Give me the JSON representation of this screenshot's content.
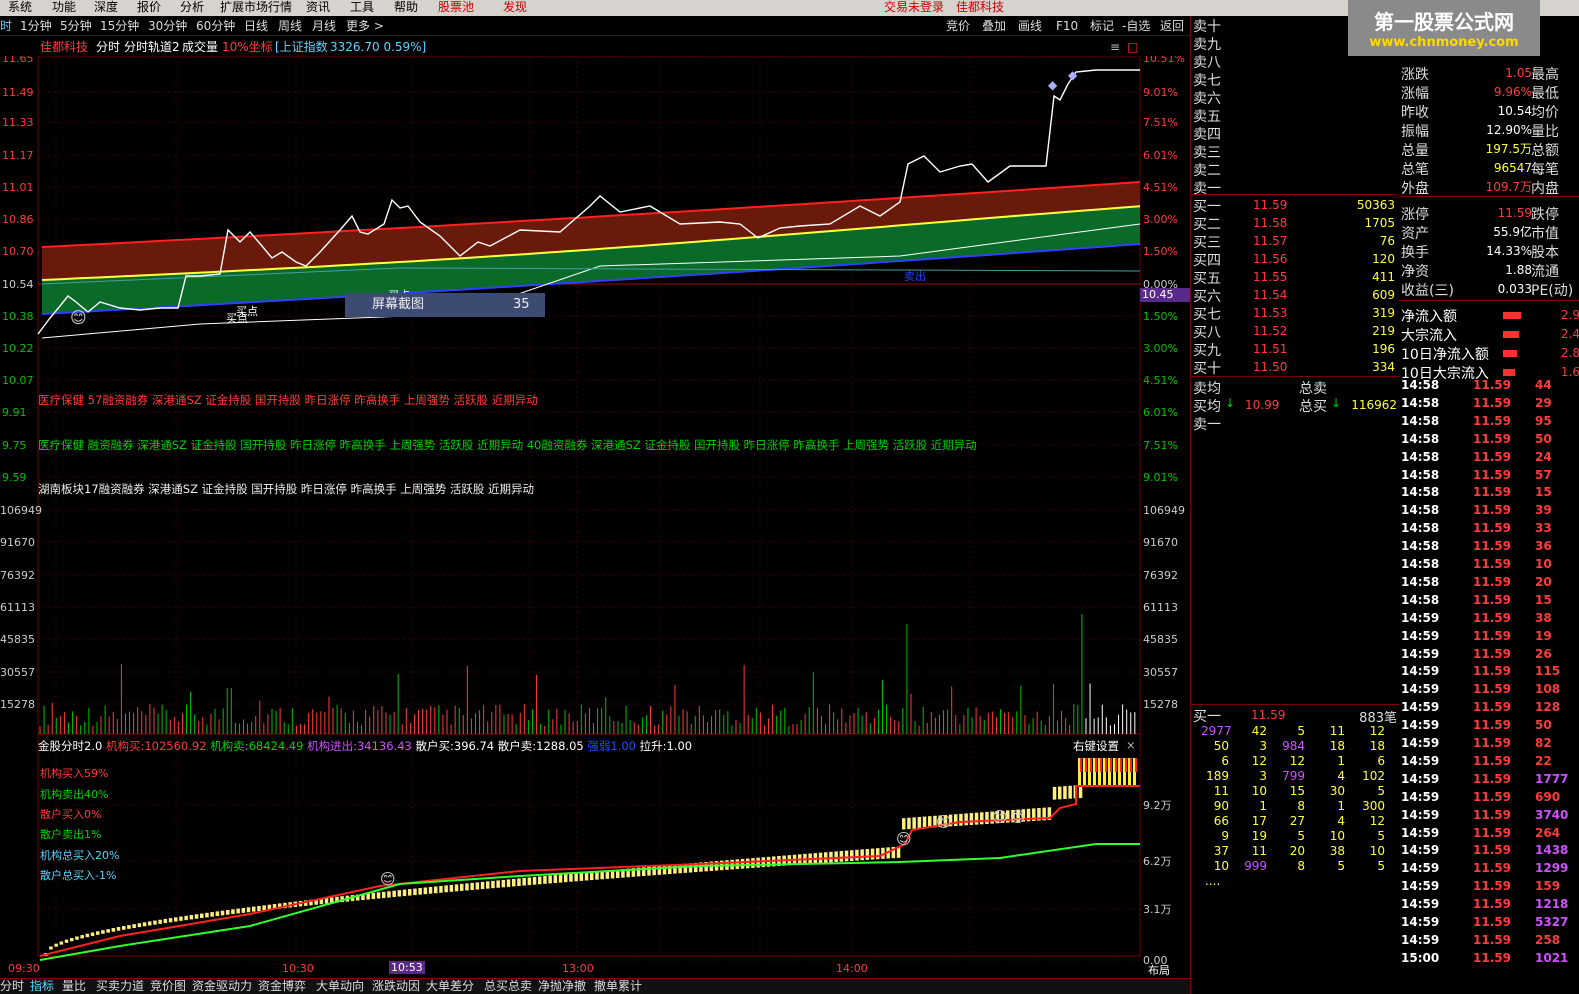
{
  "menu": [
    "系统",
    "功能",
    "深度",
    "报价",
    "分析",
    "扩展市场行情",
    "资讯",
    "工具",
    "帮助",
    "股票池",
    "发现",
    "交易未登录",
    "佳都科技"
  ],
  "watermark": {
    "title": "第一股票公式网",
    "url": "www.chnmoney.com"
  },
  "period_tabs": [
    "时",
    "1分钟",
    "5分钟",
    "15分钟",
    "30分钟",
    "60分钟",
    "日线",
    "周线",
    "月线",
    "更多 >"
  ],
  "right_tools": [
    "竞价",
    "叠加",
    "画线",
    "F10",
    "标记",
    "-自选",
    "返回"
  ],
  "title": {
    "stock": "佳都科技",
    "items": [
      "分时",
      "分时轨道2",
      "成交量"
    ],
    "coord": "10%坐标",
    "index": "[上证指数",
    "index_val": "3326.70 0.59%]"
  },
  "price_axis": [
    "11.65",
    "11.49",
    "11.33",
    "11.17",
    "11.01",
    "10.86",
    "10.70",
    "10.54",
    "10.38",
    "10.22",
    "10.07",
    "9.91",
    "9.75",
    "9.59"
  ],
  "pct_axis": [
    "10.51%",
    "9.01%",
    "7.51%",
    "6.01%",
    "4.51%",
    "3.00%",
    "1.50%",
    "0.00%",
    "1.50%",
    "3.00%",
    "4.51%",
    "6.01%",
    "7.51%",
    "9.01%"
  ],
  "cur_price": "10.45",
  "annotations": {
    "buy1": "买点",
    "buy2": "买点",
    "buy3": "买点",
    "sell_label": "卖出",
    "screenshot": "屏幕截图",
    "screenshot_num": "35"
  },
  "concepts": [
    "医疗保健 57融资融券 深港通SZ 证金持股 国开持股 昨日涨停 昨高换手 上周强势 活跃股 近期异动",
    "医疗保健 融资融券 深港通SZ 证金持股 国开持股 昨日涨停 昨高换手 上周强势 活跃股 近期异动 40融资融券 深港通SZ 证金持股 国开持股 昨日涨停 昨高换手 上周强势 活跃股 近期异动",
    "湖南板块17融资融券 深港通SZ 证金持股 国开持股 昨日涨停 昨高换手 上周强势 活跃股 近期异动"
  ],
  "vol_axis": [
    "106949",
    "91670",
    "76392",
    "61113",
    "45835",
    "30557",
    "15278"
  ],
  "ind": {
    "name": "金股分时2.0",
    "a": "机构买:",
    "a_v": "102560.92",
    "b": "机构卖:",
    "b_v": "68424.49",
    "c": "机构进出:",
    "c_v": "34136.43",
    "d": "散户买:",
    "d_v": "396.74",
    "e": "散户卖:",
    "e_v": "1288.05",
    "f": "强弱",
    "f_v": "1.00",
    "g": "拉升:",
    "g_v": "1.00",
    "settings": "右键设置",
    "close": "×"
  },
  "ind_labels": [
    "机构买入59%",
    "机构卖出40%",
    "散户买入0%",
    "散户卖出1%",
    "机构总买入20%",
    "散户总买入-1%"
  ],
  "ind_axis": [
    "9.2万",
    "6.2万",
    "3.1万",
    "0.00"
  ],
  "time_axis": [
    "09:30",
    "10:30",
    "10:53",
    "13:00",
    "14:00"
  ],
  "layout_label": "布局",
  "bottom_tabs": [
    "分时",
    "指标",
    "量比",
    "买卖力道",
    "竞价图",
    "资金驱动力",
    "资金博弈",
    "大单动向",
    "涨跌动因",
    "大单差分",
    "总买总卖",
    "净抛净撤",
    "撤单累计"
  ],
  "sell_levels": [
    "卖十",
    "卖九",
    "卖八",
    "卖七",
    "卖六",
    "卖五",
    "卖四",
    "卖三",
    "卖二",
    "卖一"
  ],
  "buy_levels": [
    {
      "l": "买一",
      "p": "11.59",
      "v": "50363"
    },
    {
      "l": "买二",
      "p": "11.58",
      "v": "1705"
    },
    {
      "l": "买三",
      "p": "11.57",
      "v": "76"
    },
    {
      "l": "买四",
      "p": "11.56",
      "v": "120"
    },
    {
      "l": "买五",
      "p": "11.55",
      "v": "411"
    },
    {
      "l": "买六",
      "p": "11.54",
      "v": "609"
    },
    {
      "l": "买七",
      "p": "11.53",
      "v": "319"
    },
    {
      "l": "买八",
      "p": "11.52",
      "v": "219"
    },
    {
      "l": "买九",
      "p": "11.51",
      "v": "196"
    },
    {
      "l": "买十",
      "p": "11.50",
      "v": "334"
    }
  ],
  "quote": [
    {
      "k": "涨跌",
      "v": "1.05",
      "k2": "最高"
    },
    {
      "k": "涨幅",
      "v": "9.96%",
      "k2": "最低"
    },
    {
      "k": "昨收",
      "v": "10.54",
      "k2": "均价"
    },
    {
      "k": "振幅",
      "v": "12.90%",
      "k2": "量比"
    },
    {
      "k": "总量",
      "v": "197.5万",
      "k2": "总额"
    },
    {
      "k": "总笔",
      "v": "96547",
      "k2": "每笔"
    },
    {
      "k": "外盘",
      "v": "109.7万",
      "k2": "内盘"
    }
  ],
  "quote2": [
    {
      "k": "涨停",
      "v": "11.59",
      "k2": "跌停"
    },
    {
      "k": "资产",
      "v": "55.9亿",
      "k2": "市值"
    },
    {
      "k": "换手",
      "v": "14.33%",
      "k2": "股本"
    },
    {
      "k": "净资",
      "v": "1.88",
      "k2": "流通"
    },
    {
      "k": "收益(三)",
      "v": "0.033",
      "k2": "PE(动)"
    }
  ],
  "flow": [
    {
      "k": "净流入额",
      "v": "2.9"
    },
    {
      "k": "大宗流入",
      "v": "2.4"
    },
    {
      "k": "10日净流入额",
      "v": "2.8"
    },
    {
      "k": "10日大宗流入",
      "v": "1.6"
    }
  ],
  "avg": {
    "sell_avg": "卖均",
    "total_sell": "总卖",
    "buy_avg": "买均",
    "buy_avg_v": "10.99",
    "total_buy": "总买",
    "total_buy_v": "116962",
    "sell1": "卖一"
  },
  "queue": {
    "label": "买一",
    "price": "11.59",
    "count": "883笔",
    "rows": [
      [
        "2977",
        "42",
        "5",
        "11",
        "12"
      ],
      [
        "50",
        "3",
        "984",
        "18",
        "18"
      ],
      [
        "6",
        "12",
        "12",
        "1",
        "6"
      ],
      [
        "189",
        "3",
        "799",
        "4",
        "102"
      ],
      [
        "11",
        "10",
        "15",
        "30",
        "5"
      ],
      [
        "90",
        "1",
        "8",
        "1",
        "300"
      ],
      [
        "66",
        "17",
        "27",
        "4",
        "12"
      ],
      [
        "9",
        "19",
        "5",
        "10",
        "5"
      ],
      [
        "37",
        "11",
        "20",
        "38",
        "10"
      ],
      [
        "10",
        "999",
        "8",
        "5",
        "5"
      ]
    ],
    "more": "...."
  },
  "ticks": [
    [
      "14:58",
      "11.59",
      "44"
    ],
    [
      "14:58",
      "11.59",
      "29"
    ],
    [
      "14:58",
      "11.59",
      "95"
    ],
    [
      "14:58",
      "11.59",
      "50"
    ],
    [
      "14:58",
      "11.59",
      "24"
    ],
    [
      "14:58",
      "11.59",
      "57"
    ],
    [
      "14:58",
      "11.59",
      "15"
    ],
    [
      "14:58",
      "11.59",
      "39"
    ],
    [
      "14:58",
      "11.59",
      "33"
    ],
    [
      "14:58",
      "11.59",
      "36"
    ],
    [
      "14:58",
      "11.59",
      "10"
    ],
    [
      "14:58",
      "11.59",
      "20"
    ],
    [
      "14:58",
      "11.59",
      "15"
    ],
    [
      "14:59",
      "11.59",
      "38"
    ],
    [
      "14:59",
      "11.59",
      "19"
    ],
    [
      "14:59",
      "11.59",
      "26"
    ],
    [
      "14:59",
      "11.59",
      "115"
    ],
    [
      "14:59",
      "11.59",
      "108"
    ],
    [
      "14:59",
      "11.59",
      "128"
    ],
    [
      "14:59",
      "11.59",
      "50"
    ],
    [
      "14:59",
      "11.59",
      "82"
    ],
    [
      "14:59",
      "11.59",
      "22"
    ],
    [
      "14:59",
      "11.59",
      "1777"
    ],
    [
      "14:59",
      "11.59",
      "690"
    ],
    [
      "14:59",
      "11.59",
      "3740"
    ],
    [
      "14:59",
      "11.59",
      "264"
    ],
    [
      "14:59",
      "11.59",
      "1438"
    ],
    [
      "14:59",
      "11.59",
      "1299"
    ],
    [
      "14:59",
      "11.59",
      "159"
    ],
    [
      "14:59",
      "11.59",
      "1218"
    ],
    [
      "14:59",
      "11.59",
      "5327"
    ],
    [
      "14:59",
      "11.59",
      "258"
    ],
    [
      "15:00",
      "11.59",
      "1021"
    ]
  ]
}
